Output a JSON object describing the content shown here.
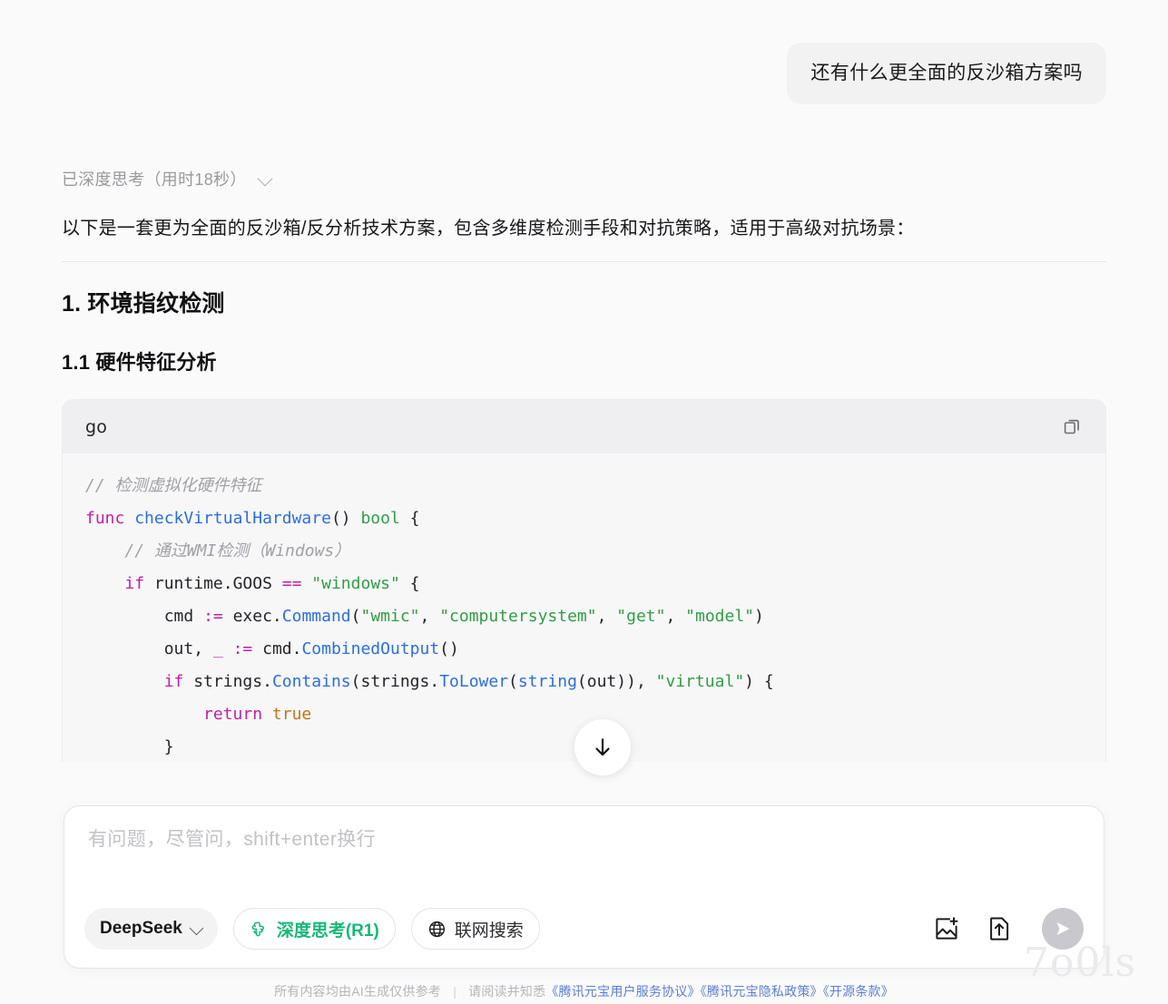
{
  "user_message": {
    "text": "还有什么更全面的反沙箱方案吗"
  },
  "thinking": {
    "label": "已深度思考（用时18秒）",
    "chevron_icon": "chevron-down-icon"
  },
  "answer": {
    "intro": "以下是一套更为全面的反沙箱/反分析技术方案，包含多维度检测手段和对抗策略，适用于高级对抗场景：",
    "heading_1": "1. 环境指纹检测",
    "heading_1_1": "1.1 硬件特征分析"
  },
  "code_block": {
    "language": "go",
    "copy_icon": "copy-icon",
    "lines": [
      {
        "indent": 0,
        "tokens": [
          {
            "t": "com",
            "v": "// 检测虚拟化硬件特征"
          }
        ]
      },
      {
        "indent": 0,
        "tokens": [
          {
            "t": "kw",
            "v": "func"
          },
          {
            "t": "pl",
            "v": " "
          },
          {
            "t": "fn",
            "v": "checkVirtualHardware"
          },
          {
            "t": "pl",
            "v": "() "
          },
          {
            "t": "type",
            "v": "bool"
          },
          {
            "t": "pl",
            "v": " {"
          }
        ]
      },
      {
        "indent": 1,
        "tokens": [
          {
            "t": "com",
            "v": "// 通过WMI检测（Windows）"
          }
        ]
      },
      {
        "indent": 1,
        "tokens": [
          {
            "t": "kw",
            "v": "if"
          },
          {
            "t": "pl",
            "v": " runtime.GOOS "
          },
          {
            "t": "kw",
            "v": "=="
          },
          {
            "t": "pl",
            "v": " "
          },
          {
            "t": "str",
            "v": "\"windows\""
          },
          {
            "t": "pl",
            "v": " {"
          }
        ]
      },
      {
        "indent": 2,
        "tokens": [
          {
            "t": "pl",
            "v": "cmd "
          },
          {
            "t": "kw",
            "v": ":="
          },
          {
            "t": "pl",
            "v": " exec."
          },
          {
            "t": "fn",
            "v": "Command"
          },
          {
            "t": "pl",
            "v": "("
          },
          {
            "t": "str",
            "v": "\"wmic\""
          },
          {
            "t": "pl",
            "v": ", "
          },
          {
            "t": "str",
            "v": "\"computersystem\""
          },
          {
            "t": "pl",
            "v": ", "
          },
          {
            "t": "str",
            "v": "\"get\""
          },
          {
            "t": "pl",
            "v": ", "
          },
          {
            "t": "str",
            "v": "\"model\""
          },
          {
            "t": "pl",
            "v": ")"
          }
        ]
      },
      {
        "indent": 2,
        "tokens": [
          {
            "t": "pl",
            "v": "out, "
          },
          {
            "t": "kw",
            "v": "_"
          },
          {
            "t": "pl",
            "v": " "
          },
          {
            "t": "kw",
            "v": ":="
          },
          {
            "t": "pl",
            "v": " cmd."
          },
          {
            "t": "fn",
            "v": "CombinedOutput"
          },
          {
            "t": "pl",
            "v": "()"
          }
        ]
      },
      {
        "indent": 2,
        "tokens": [
          {
            "t": "kw",
            "v": "if"
          },
          {
            "t": "pl",
            "v": " strings."
          },
          {
            "t": "fn",
            "v": "Contains"
          },
          {
            "t": "pl",
            "v": "(strings."
          },
          {
            "t": "fn",
            "v": "ToLower"
          },
          {
            "t": "pl",
            "v": "("
          },
          {
            "t": "fn",
            "v": "string"
          },
          {
            "t": "pl",
            "v": "(out)), "
          },
          {
            "t": "str",
            "v": "\"virtual\""
          },
          {
            "t": "pl",
            "v": ") {"
          }
        ]
      },
      {
        "indent": 3,
        "tokens": [
          {
            "t": "kw",
            "v": "return"
          },
          {
            "t": "pl",
            "v": " "
          },
          {
            "t": "num",
            "v": "true"
          }
        ]
      },
      {
        "indent": 2,
        "tokens": [
          {
            "t": "pl",
            "v": "}"
          }
        ]
      },
      {
        "indent": 1,
        "tokens": [
          {
            "t": "pl",
            "v": "}"
          }
        ]
      }
    ]
  },
  "scroll_to_bottom": {
    "icon": "arrow-down-icon"
  },
  "composer": {
    "placeholder": "有问题，尽管问，shift+enter换行",
    "value": "",
    "model_chip": {
      "label": "DeepSeek",
      "chevron_icon": "chevron-down-icon"
    },
    "deep_think_chip": {
      "label": "深度思考(R1)",
      "icon": "pinwheel-icon",
      "active": true,
      "color": "#16b877"
    },
    "web_search_chip": {
      "label": "联网搜索",
      "icon": "globe-icon",
      "active": false
    },
    "image_upload": {
      "icon": "image-add-icon"
    },
    "file_upload": {
      "icon": "file-upload-icon"
    },
    "send": {
      "icon": "send-icon",
      "color": "#c9c9cd"
    }
  },
  "footer": {
    "disclaimer": "所有内容均由AI生成仅供参考",
    "separator": "|",
    "read_prefix": "请阅读并知悉",
    "links": [
      "《腾讯元宝用户服务协议》",
      "《腾讯元宝隐私政策》",
      "《开源条款》"
    ]
  },
  "watermark": {
    "text": "7o0ls"
  }
}
